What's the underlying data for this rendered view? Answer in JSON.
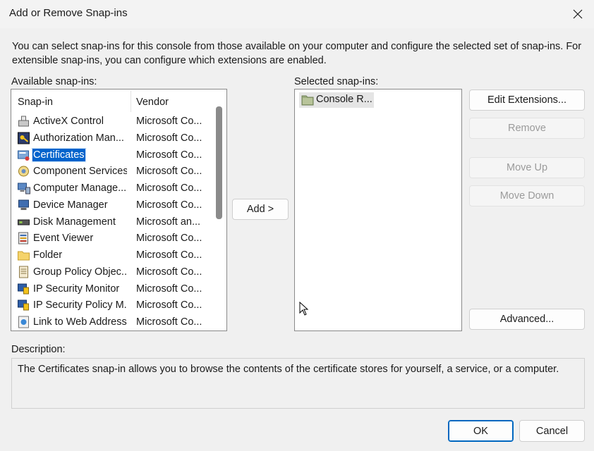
{
  "window": {
    "title": "Add or Remove Snap-ins",
    "close_icon": "close-icon"
  },
  "intro_text": "You can select snap-ins for this console from those available on your computer and configure the selected set of snap-ins. For extensible snap-ins, you can configure which extensions are enabled.",
  "available": {
    "label": "Available snap-ins:",
    "columns": [
      "Snap-in",
      "Vendor"
    ],
    "items": [
      {
        "name": "ActiveX Control",
        "vendor": "Microsoft Co...",
        "icon": "activex-control-icon"
      },
      {
        "name": "Authorization Man...",
        "vendor": "Microsoft Co...",
        "icon": "authorization-manager-icon"
      },
      {
        "name": "Certificates",
        "vendor": "Microsoft Co...",
        "icon": "certificates-icon",
        "selected": true
      },
      {
        "name": "Component Services",
        "vendor": "Microsoft Co...",
        "icon": "component-services-icon"
      },
      {
        "name": "Computer Manage...",
        "vendor": "Microsoft Co...",
        "icon": "computer-management-icon"
      },
      {
        "name": "Device Manager",
        "vendor": "Microsoft Co...",
        "icon": "device-manager-icon"
      },
      {
        "name": "Disk Management",
        "vendor": "Microsoft an...",
        "icon": "disk-management-icon"
      },
      {
        "name": "Event Viewer",
        "vendor": "Microsoft Co...",
        "icon": "event-viewer-icon"
      },
      {
        "name": "Folder",
        "vendor": "Microsoft Co...",
        "icon": "folder-icon"
      },
      {
        "name": "Group Policy Objec...",
        "vendor": "Microsoft Co...",
        "icon": "group-policy-icon"
      },
      {
        "name": "IP Security Monitor",
        "vendor": "Microsoft Co...",
        "icon": "ip-security-monitor-icon"
      },
      {
        "name": "IP Security Policy M...",
        "vendor": "Microsoft Co...",
        "icon": "ip-security-policy-icon"
      },
      {
        "name": "Link to Web Address",
        "vendor": "Microsoft Co...",
        "icon": "link-web-address-icon"
      }
    ]
  },
  "add_button": "Add >",
  "selected_panel": {
    "label": "Selected snap-ins:",
    "items": [
      {
        "name": "Console R...",
        "icon": "console-root-folder-icon"
      }
    ]
  },
  "side_buttons": {
    "edit_extensions": "Edit Extensions...",
    "remove": "Remove",
    "move_up": "Move Up",
    "move_down": "Move Down",
    "advanced": "Advanced..."
  },
  "description": {
    "label": "Description:",
    "text": "The Certificates snap-in allows you to browse the contents of the certificate stores for yourself, a service, or a computer."
  },
  "footer": {
    "ok": "OK",
    "cancel": "Cancel"
  },
  "colors": {
    "selection": "#0063cc",
    "primary_border": "#0067c0",
    "disabled_text": "#9b9b9b"
  }
}
